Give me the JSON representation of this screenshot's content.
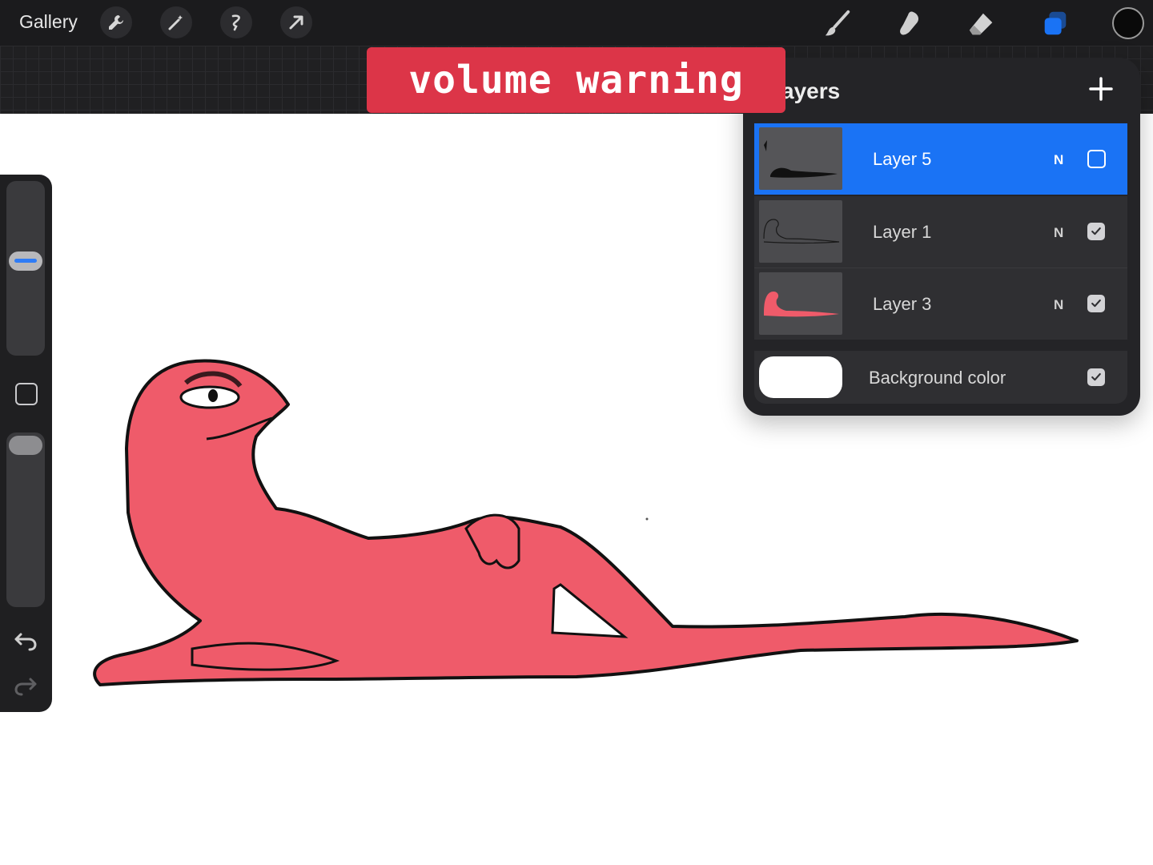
{
  "toolbar": {
    "gallery_label": "Gallery",
    "left_tools": [
      "wrench-icon",
      "magic-wand-icon",
      "selection-icon",
      "transform-arrow-icon"
    ],
    "right_tools": [
      "brush-icon",
      "smudge-icon",
      "eraser-icon",
      "layers-icon"
    ],
    "active_color": "#0a0a0a",
    "accent_color": "#1a73f5"
  },
  "banner": {
    "text": "volume warning",
    "color": "#dc3548"
  },
  "layers_panel": {
    "title": "ayers",
    "layers": [
      {
        "name": "Layer 5",
        "blend": "N",
        "visible": false,
        "selected": true
      },
      {
        "name": "Layer 1",
        "blend": "N",
        "visible": true,
        "selected": false
      },
      {
        "name": "Layer 3",
        "blend": "N",
        "visible": true,
        "selected": false
      }
    ],
    "background": {
      "label": "Background color",
      "visible": true,
      "color": "#ffffff"
    }
  },
  "sidebar": {
    "brush_size_level": 0.55,
    "opacity_level": 1.0
  },
  "canvas": {
    "figure_color": "#ef5b6a"
  }
}
